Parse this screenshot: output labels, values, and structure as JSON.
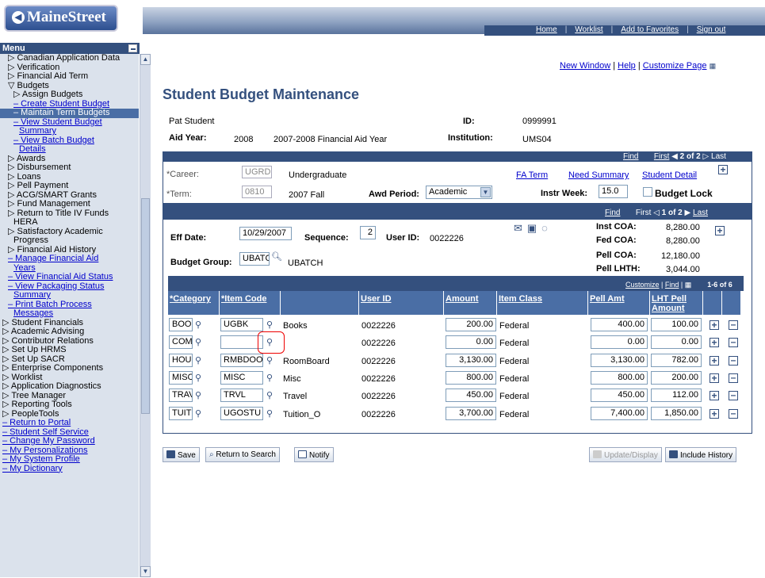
{
  "app": {
    "logo": "MaineStreet"
  },
  "top_links": [
    "Home",
    "Worklist",
    "Add to Favorites",
    "Sign out"
  ],
  "page_links": {
    "new_window": "New Window",
    "help": "Help",
    "customize": "Customize Page"
  },
  "menu": {
    "title": "Menu",
    "items": [
      {
        "t": "▷ Canadian Application Data",
        "ind": 1
      },
      {
        "t": "▷ Verification",
        "ind": 1
      },
      {
        "t": "▷ Financial Aid Term",
        "ind": 1
      },
      {
        "t": "▽ Budgets",
        "ind": 1
      },
      {
        "t": "▷ Assign Budgets",
        "ind": 2
      },
      {
        "t": "– Create Student Budget",
        "ind": 2,
        "link": true
      },
      {
        "t": "– Maintain Term Budgets",
        "ind": 2,
        "hl": true
      },
      {
        "t": "– View Student Budget",
        "ind": 2,
        "link": true
      },
      {
        "t": "Summary",
        "ind": 3,
        "link": true
      },
      {
        "t": "– View Batch Budget",
        "ind": 2,
        "link": true
      },
      {
        "t": "Details",
        "ind": 3,
        "link": true
      },
      {
        "t": "▷ Awards",
        "ind": 1
      },
      {
        "t": "▷ Disbursement",
        "ind": 1
      },
      {
        "t": "▷ Loans",
        "ind": 1
      },
      {
        "t": "▷ Pell Payment",
        "ind": 1
      },
      {
        "t": "▷ ACG/SMART Grants",
        "ind": 1
      },
      {
        "t": "▷ Fund Management",
        "ind": 1
      },
      {
        "t": "▷ Return to Title IV Funds",
        "ind": 1
      },
      {
        "t": "HERA",
        "ind": 2
      },
      {
        "t": "▷ Satisfactory Academic",
        "ind": 1
      },
      {
        "t": "Progress",
        "ind": 2
      },
      {
        "t": "▷ Financial Aid History",
        "ind": 1
      },
      {
        "t": "– Manage Financial Aid",
        "ind": 1,
        "link": true
      },
      {
        "t": "Years",
        "ind": 2,
        "link": true
      },
      {
        "t": "– View Financial Aid Status",
        "ind": 1,
        "link": true
      },
      {
        "t": "– View Packaging Status",
        "ind": 1,
        "link": true
      },
      {
        "t": "Summary",
        "ind": 2,
        "link": true
      },
      {
        "t": "– Print Batch Process",
        "ind": 1,
        "link": true
      },
      {
        "t": "Messages",
        "ind": 2,
        "link": true
      },
      {
        "t": "▷ Student Financials",
        "ind": 0
      },
      {
        "t": "▷ Academic Advising",
        "ind": 0
      },
      {
        "t": "▷ Contributor Relations",
        "ind": 0
      },
      {
        "t": "▷ Set Up HRMS",
        "ind": 0
      },
      {
        "t": "▷ Set Up SACR",
        "ind": 0
      },
      {
        "t": "▷ Enterprise Components",
        "ind": 0
      },
      {
        "t": "▷ Worklist",
        "ind": 0
      },
      {
        "t": "▷ Application Diagnostics",
        "ind": 0
      },
      {
        "t": "▷ Tree Manager",
        "ind": 0
      },
      {
        "t": "▷ Reporting Tools",
        "ind": 0
      },
      {
        "t": "▷ PeopleTools",
        "ind": 0
      },
      {
        "t": "– Return to Portal",
        "ind": 0,
        "link": true
      },
      {
        "t": "– Student Self Service",
        "ind": 0,
        "link": true
      },
      {
        "t": "– Change My Password",
        "ind": 0,
        "link": true
      },
      {
        "t": "– My Personalizations",
        "ind": 0,
        "link": true
      },
      {
        "t": "– My System Profile",
        "ind": 0,
        "link": true
      },
      {
        "t": "– My Dictionary",
        "ind": 0,
        "link": true
      }
    ]
  },
  "page": {
    "title": "Student Budget Maintenance",
    "student": "Pat Student",
    "id_label": "ID:",
    "id": "0999991",
    "aid_year_label": "Aid Year:",
    "aid_year": "2008",
    "aid_year_desc": "2007-2008 Financial Aid Year",
    "inst_label": "Institution:",
    "inst": "UMS04"
  },
  "term_nav": {
    "find": "Find",
    "first": "First",
    "of": "2 of 2",
    "last": "Last"
  },
  "term": {
    "career_label": "*Career:",
    "career": "UGRD",
    "career_desc": "Undergraduate",
    "term_label": "*Term:",
    "term": "0810",
    "term_desc": "2007 Fall",
    "awd_label": "Awd Period:",
    "awd": "Academic",
    "instr_label": "Instr Week:",
    "instr": "15.0",
    "lock": "Budget Lock",
    "fa_term": "FA Term",
    "need_summary": "Need Summary",
    "student_detail": "Student Detail"
  },
  "eff_nav": {
    "find": "Find",
    "first": "First",
    "of": "1 of 2",
    "last": "Last"
  },
  "eff": {
    "date_label": "Eff Date:",
    "date": "10/29/2007",
    "seq_label": "Sequence:",
    "seq": "2",
    "user_label": "User ID:",
    "user": "0022226",
    "bg_label": "Budget Group:",
    "bg": "UBATCH",
    "bg_desc": "UBATCH",
    "inst_coa_label": "Inst COA:",
    "inst_coa": "8,280.00",
    "fed_coa_label": "Fed COA:",
    "fed_coa": "8,280.00",
    "pell_coa_label": "Pell COA:",
    "pell_coa": "12,180.00",
    "pell_lht_label": "Pell LHTH:",
    "pell_lht": "3,044.00"
  },
  "grid_nav": {
    "customize": "Customize",
    "find": "Find",
    "count": "1-6 of 6"
  },
  "grid": {
    "headers": [
      "*Category",
      "*Item Code",
      "",
      "User ID",
      "Amount",
      "Item Class",
      "Pell Amt",
      "LHT Pell Amount"
    ],
    "rows": [
      [
        "BOOK",
        "UGBK",
        "Books",
        "0022226",
        "200.00",
        "Federal",
        "400.00",
        "100.00"
      ],
      [
        "COMP",
        "",
        "",
        "0022226",
        "0.00",
        "Federal",
        "0.00",
        "0.00"
      ],
      [
        "HOUS",
        "RMBDOO",
        "RoomBoard",
        "0022226",
        "3,130.00",
        "Federal",
        "3,130.00",
        "782.00"
      ],
      [
        "MISC",
        "MISC",
        "Misc",
        "0022226",
        "800.00",
        "Federal",
        "800.00",
        "200.00"
      ],
      [
        "TRAV",
        "TRVL",
        "Travel",
        "0022226",
        "450.00",
        "Federal",
        "450.00",
        "112.00"
      ],
      [
        "TUIT",
        "UGOSTU",
        "Tuition_O",
        "0022226",
        "3,700.00",
        "Federal",
        "7,400.00",
        "1,850.00"
      ]
    ]
  },
  "buttons": {
    "save": "Save",
    "return": "Return to Search",
    "notify": "Notify",
    "update": "Update/Display",
    "history": "Include History"
  }
}
